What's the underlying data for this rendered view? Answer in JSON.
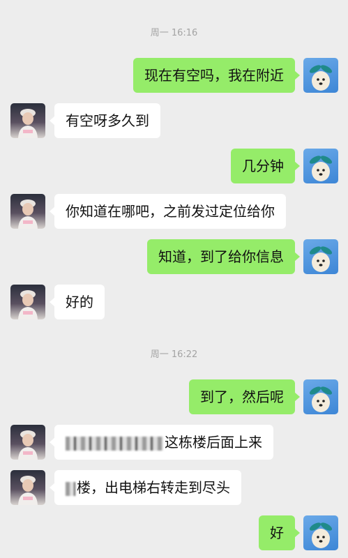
{
  "timestamps": [
    "周一 16:16",
    "周一 16:22"
  ],
  "messages": [
    {
      "from": "me",
      "text": "现在有空吗，我在附近"
    },
    {
      "from": "other",
      "text": "有空呀多久到"
    },
    {
      "from": "me",
      "text": "几分钟"
    },
    {
      "from": "other",
      "text": "你知道在哪吧，之前发过定位给你"
    },
    {
      "from": "me",
      "text": "知道，到了给你信息"
    },
    {
      "from": "other",
      "text": "好的"
    },
    {
      "from": "me",
      "text": "到了，然后呢"
    },
    {
      "from": "other",
      "text": "这栋楼后面上来",
      "redacted_prefix": true
    },
    {
      "from": "other",
      "text": "楼，出电梯右转走到尽头",
      "redacted_prefix": true
    },
    {
      "from": "me",
      "text": "好"
    }
  ],
  "colors": {
    "background": "#ededed",
    "my_bubble": "#95ec69",
    "other_bubble": "#ffffff",
    "timestamp": "#a3a3a3"
  },
  "icons": {
    "my_avatar": "dog-avatar-icon",
    "other_avatar": "user-photo-avatar"
  }
}
